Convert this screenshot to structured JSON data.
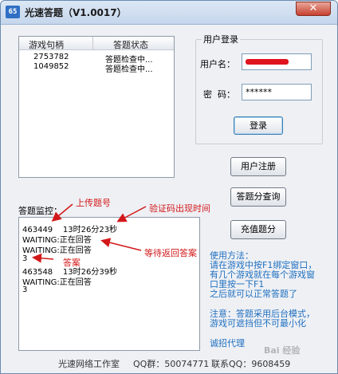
{
  "window": {
    "title": "光速答题（V1.0017）",
    "close_symbol": "✕",
    "icon_text": "65"
  },
  "game_list": {
    "columns": [
      "游戏句柄",
      "答题状态"
    ],
    "rows": [
      {
        "handle": "2753782",
        "status": "答题检查中..."
      },
      {
        "handle": "1049852",
        "status": "答题检查中..."
      }
    ]
  },
  "login": {
    "group_title": "用户登录",
    "username_label": "用户名：",
    "password_label": "密  码：",
    "password_value": "******",
    "login_button": "登录"
  },
  "buttons": {
    "register": "用户注册",
    "query_points": "答题分查询",
    "recharge": "充值题分"
  },
  "monitor": {
    "label": "答题监控：",
    "lines": [
      "463449    13时26分23秒",
      "WAITING:正在回答",
      "WAITING:正在回答",
      "3",
      "463548    13时26分39秒",
      "WAITING:正在回答",
      "3"
    ]
  },
  "annotations": {
    "upload": "上传题号",
    "captcha_time": "验证码出现时间",
    "wait_answer": "等待返回答案",
    "answer": "答案"
  },
  "instructions": {
    "usage_title": "使用方法：",
    "usage_lines": [
      "请在游戏中按F1绑定窗口，",
      "有几个游戏就在每个游戏窗",
      "口里按一下F1",
      "之后就可以正常答题了"
    ],
    "note_lines": [
      "注意：答题采用后台模式，",
      "游戏可遮挡但不可最小化"
    ],
    "agent": "诚招代理"
  },
  "footer": {
    "studio": "光速网络工作室",
    "qq_group": "QQ群：50074771",
    "contact": "联系QQ：9608459"
  },
  "watermark": "Bai 经验",
  "colors": {
    "annotation": "#d3181a",
    "info_text": "#1f6fbf",
    "redaction": "#e0141e"
  }
}
